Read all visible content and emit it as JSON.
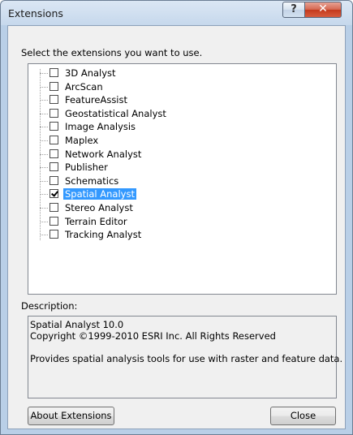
{
  "window": {
    "title": "Extensions"
  },
  "titlebar": {
    "help_glyph": "?",
    "close_glyph": "✕"
  },
  "prompt": "Select the extensions you want to use.",
  "extensions": [
    {
      "label": "3D Analyst",
      "checked": false
    },
    {
      "label": "ArcScan",
      "checked": false
    },
    {
      "label": "FeatureAssist",
      "checked": false
    },
    {
      "label": "Geostatistical Analyst",
      "checked": false
    },
    {
      "label": "Image Analysis",
      "checked": false
    },
    {
      "label": "Maplex",
      "checked": false
    },
    {
      "label": "Network Analyst",
      "checked": false
    },
    {
      "label": "Publisher",
      "checked": false
    },
    {
      "label": "Schematics",
      "checked": false
    },
    {
      "label": "Spatial Analyst",
      "checked": true,
      "selected": true
    },
    {
      "label": "Stereo Analyst",
      "checked": false
    },
    {
      "label": "Terrain Editor",
      "checked": false
    },
    {
      "label": "Tracking Analyst",
      "checked": false
    }
  ],
  "description": {
    "label": "Description:",
    "line1": "Spatial Analyst 10.0",
    "line2": "Copyright ©1999-2010 ESRI Inc. All Rights Reserved",
    "line3": "Provides spatial analysis tools for use with raster and feature data."
  },
  "buttons": {
    "about": "About Extensions",
    "close": "Close"
  },
  "colors": {
    "selection": "#3399ff",
    "close_button": "#c4391c"
  }
}
